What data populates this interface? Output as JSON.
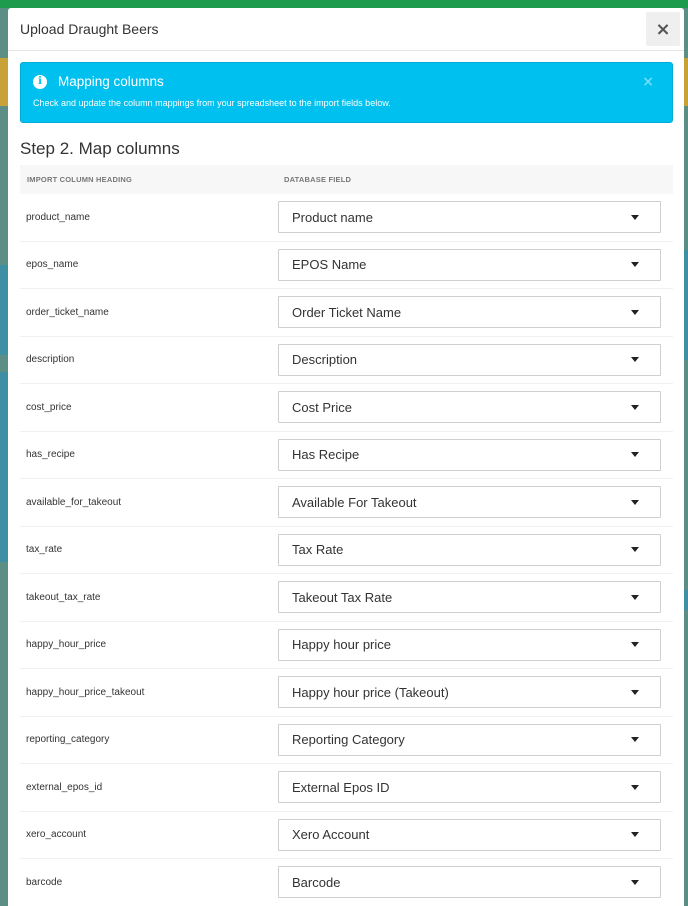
{
  "modal": {
    "title": "Upload Draught Beers",
    "close_label": "×"
  },
  "alert": {
    "icon": "info-icon",
    "title": "Mapping columns",
    "text": "Check and update the column mappings from your spreadsheet to the import fields below.",
    "close_label": "×",
    "color": "#00c0ef"
  },
  "step_title": "Step 2. Map columns",
  "table": {
    "headers": [
      "IMPORT COLUMN HEADING",
      "DATABASE FIELD"
    ],
    "rows": [
      {
        "column": "product_name",
        "field": "Product name"
      },
      {
        "column": "epos_name",
        "field": "EPOS Name"
      },
      {
        "column": "order_ticket_name",
        "field": "Order Ticket Name"
      },
      {
        "column": "description",
        "field": "Description"
      },
      {
        "column": "cost_price",
        "field": "Cost Price"
      },
      {
        "column": "has_recipe",
        "field": "Has Recipe"
      },
      {
        "column": "available_for_takeout",
        "field": "Available For Takeout"
      },
      {
        "column": "tax_rate",
        "field": "Tax Rate"
      },
      {
        "column": "takeout_tax_rate",
        "field": "Takeout Tax Rate"
      },
      {
        "column": "happy_hour_price",
        "field": "Happy hour price"
      },
      {
        "column": "happy_hour_price_takeout",
        "field": "Happy hour price (Takeout)"
      },
      {
        "column": "reporting_category",
        "field": "Reporting Category"
      },
      {
        "column": "external_epos_id",
        "field": "External Epos ID"
      },
      {
        "column": "xero_account",
        "field": "Xero Account"
      },
      {
        "column": "barcode",
        "field": "Barcode"
      }
    ]
  }
}
